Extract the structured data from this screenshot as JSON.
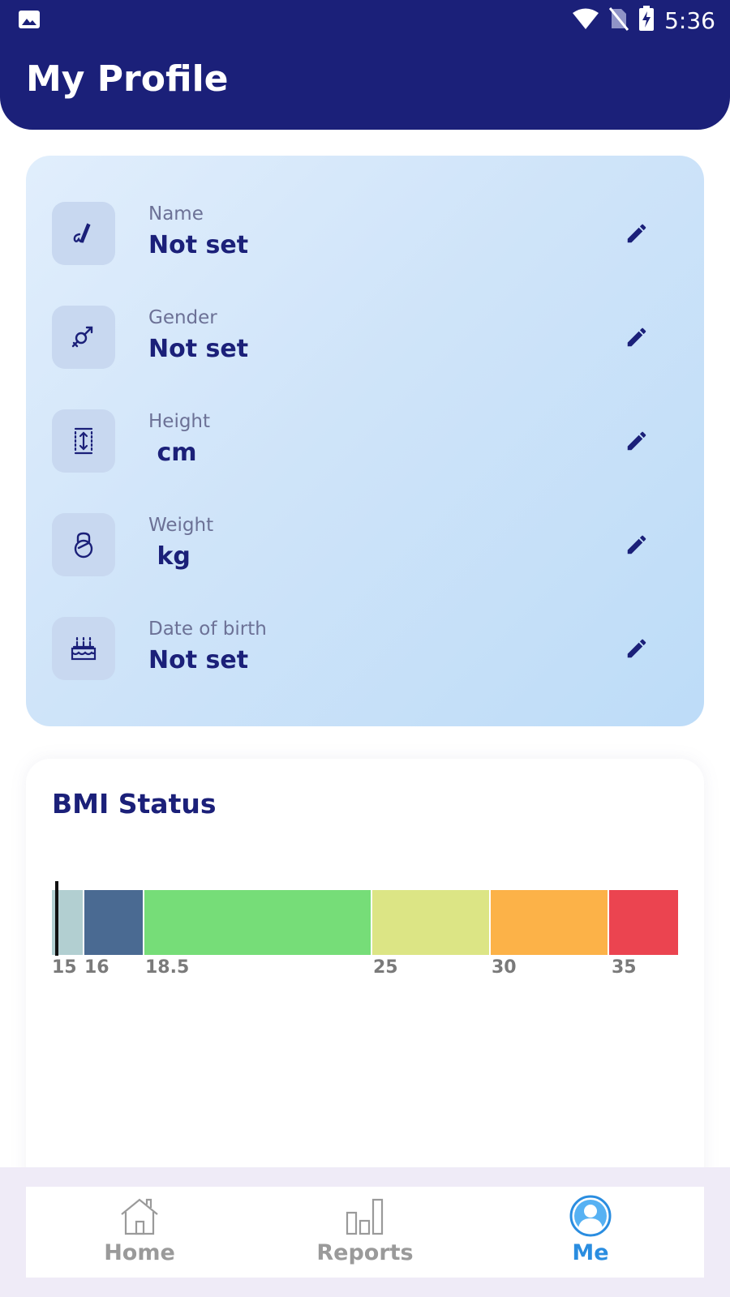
{
  "status_bar": {
    "time": "5:36"
  },
  "header": {
    "title": "My Profile"
  },
  "profile": {
    "rows": [
      {
        "label": "Name",
        "value": "Not set",
        "icon": "signature-icon"
      },
      {
        "label": "Gender",
        "value": "Not set",
        "icon": "gender-icon"
      },
      {
        "label": "Height",
        "value": " cm",
        "icon": "height-icon"
      },
      {
        "label": "Weight",
        "value": " kg",
        "icon": "kettlebell-icon"
      },
      {
        "label": "Date of birth",
        "value": "Not set",
        "icon": "birthday-cake-icon"
      }
    ]
  },
  "bmi": {
    "title": "BMI Status",
    "ticks": [
      "15",
      "16",
      "18.5",
      "25",
      "30",
      "35"
    ],
    "segments": [
      {
        "from": 15,
        "to": 16,
        "color": "#b2cfd1"
      },
      {
        "from": 16,
        "to": 18.5,
        "color": "#4a6a92"
      },
      {
        "from": 18.5,
        "to": 25,
        "color": "#76dd78"
      },
      {
        "from": 25,
        "to": 30,
        "color": "#dce585"
      },
      {
        "from": 30,
        "to": 35,
        "color": "#fcb248"
      },
      {
        "from": 35,
        "to": 40,
        "color": "#eb4450"
      }
    ]
  },
  "nav": {
    "items": [
      {
        "label": "Home",
        "icon": "home-icon",
        "active": false
      },
      {
        "label": "Reports",
        "icon": "bar-chart-icon",
        "active": false
      },
      {
        "label": "Me",
        "icon": "profile-icon",
        "active": true
      }
    ]
  },
  "colors": {
    "primary": "#1b2079",
    "accent": "#2a8de0"
  }
}
